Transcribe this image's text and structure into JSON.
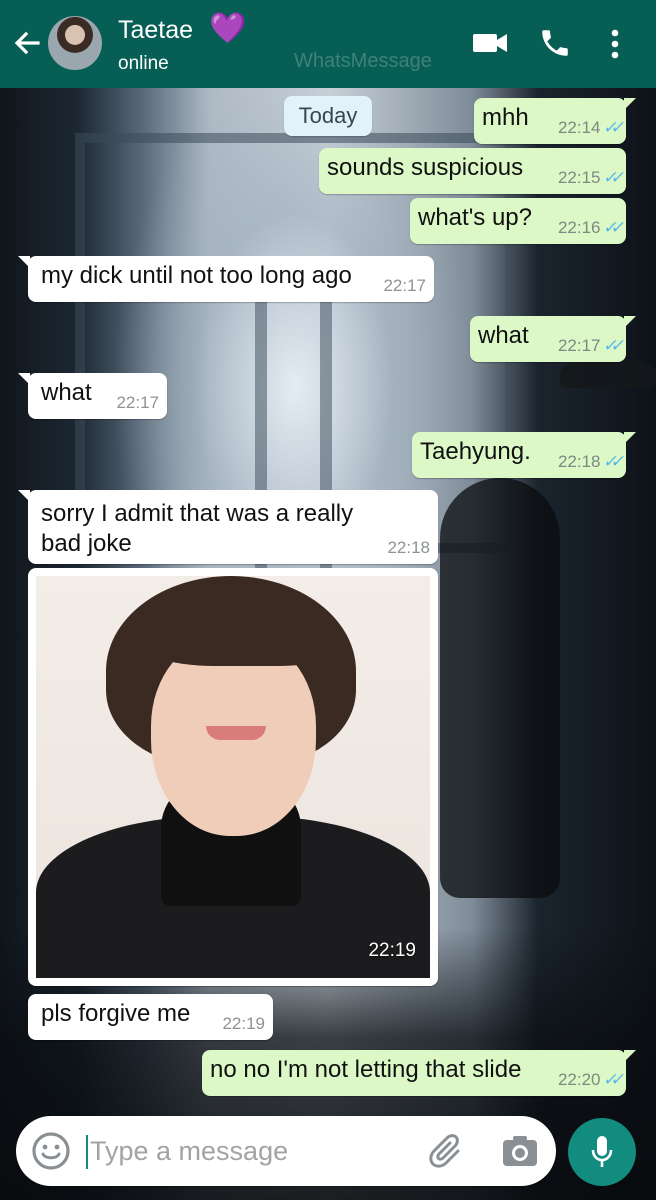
{
  "header": {
    "contact_name": "Taetae",
    "name_emoji": "💜",
    "status": "online",
    "watermark": "WhatsMessage",
    "colors": {
      "bar": "#075e54",
      "heart": "#8a2be2"
    },
    "icons": [
      "back-arrow-icon",
      "video-call-icon",
      "phone-icon",
      "more-options-icon"
    ]
  },
  "chat": {
    "date_divider": "Today",
    "messages": [
      {
        "dir": "out",
        "text": "mhh",
        "time": "22:14"
      },
      {
        "dir": "out",
        "text": "sounds suspicious",
        "time": "22:15"
      },
      {
        "dir": "out",
        "text": "what's up?",
        "time": "22:16"
      },
      {
        "dir": "in",
        "text": "my dick until not too long ago",
        "time": "22:17"
      },
      {
        "dir": "out",
        "text": "what",
        "time": "22:17"
      },
      {
        "dir": "in",
        "text": "what",
        "time": "22:17"
      },
      {
        "dir": "out",
        "text": "Taehyung.",
        "time": "22:18"
      },
      {
        "dir": "in",
        "text_line1": "sorry I admit that was a really",
        "text_line2": "bad joke",
        "time": "22:18"
      },
      {
        "dir": "in",
        "type": "photo",
        "time": "22:19"
      },
      {
        "dir": "in",
        "text": "pls forgive me",
        "time": "22:19"
      },
      {
        "dir": "out",
        "text": "no no I'm not letting that slide",
        "time": "22:20"
      }
    ],
    "colors": {
      "outgoing": "#dcf8c6",
      "incoming": "#ffffff",
      "read_ticks": "#4fb6ec"
    }
  },
  "composer": {
    "placeholder": "Type a message",
    "value": "",
    "icons": [
      "emoji-icon",
      "attach-icon",
      "camera-icon",
      "mic-icon"
    ],
    "colors": {
      "mic_button": "#128c7e"
    }
  }
}
